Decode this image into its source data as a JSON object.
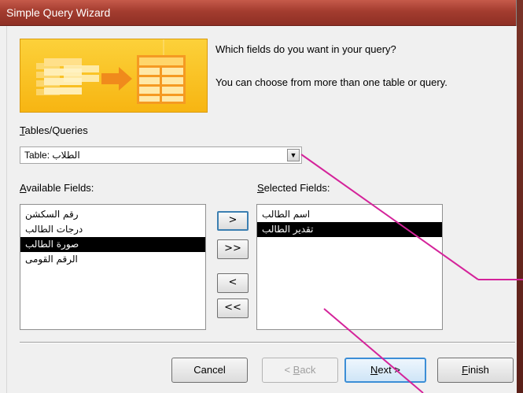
{
  "window": {
    "title": "Simple Query Wizard"
  },
  "instructions": {
    "line1": "Which fields do you want in your query?",
    "line2": "You can choose from more than one table or query."
  },
  "tables_label": {
    "hot": "T",
    "rest": "ables/Queries"
  },
  "table_combo": {
    "value": "Table: الطلاب"
  },
  "available_label": {
    "hot": "A",
    "rest": "vailable Fields:"
  },
  "selected_label": {
    "hot": "S",
    "rest": "elected Fields:"
  },
  "available_fields": [
    {
      "text": "رقم السكشن",
      "selected": false
    },
    {
      "text": "درجات الطالب",
      "selected": false
    },
    {
      "text": "صورة الطالب",
      "selected": true
    },
    {
      "text": "الرقم القومى",
      "selected": false
    }
  ],
  "selected_fields": [
    {
      "text": "اسم الطالب",
      "selected": false
    },
    {
      "text": "تقدير الطالب",
      "selected": true
    }
  ],
  "move_buttons": {
    "add_one": ">",
    "add_all": ">>",
    "remove_one": "<",
    "remove_all": "<<"
  },
  "buttons": {
    "cancel": "Cancel",
    "back_hot": "B",
    "back_pre": "< ",
    "back_rest": "ack",
    "next_hot": "N",
    "next_rest": "ext >",
    "finish_hot": "F",
    "finish_rest": "inish"
  },
  "colors": {
    "title_bar": "#a33c2f",
    "banner": "#f7b512",
    "annotation_lines": "#d4239a",
    "selection": "#000000"
  }
}
